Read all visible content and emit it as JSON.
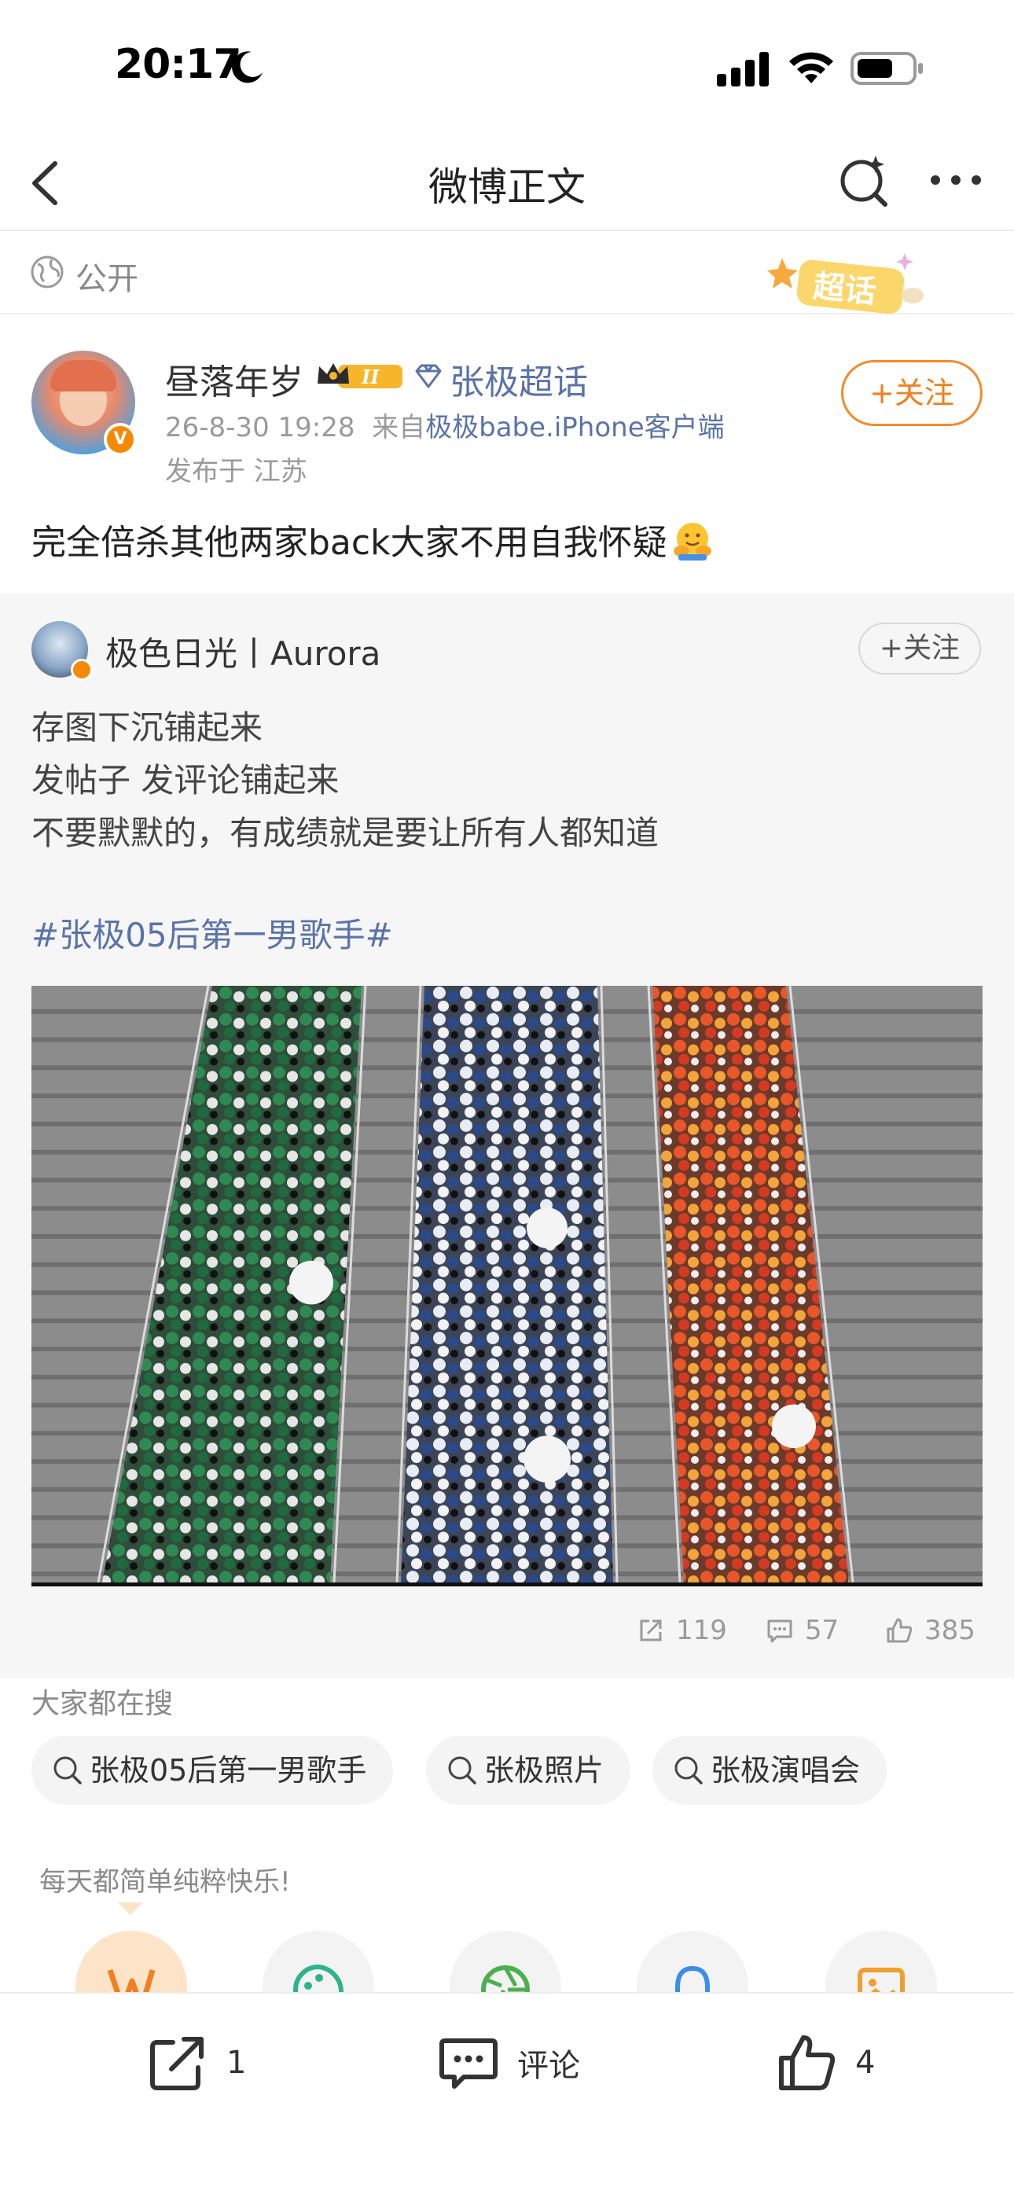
{
  "status_bar": {
    "time": "20:17"
  },
  "nav": {
    "title": "微博正文"
  },
  "visibility": {
    "label": "公开",
    "deco_text": "超话"
  },
  "author": {
    "name": "昼落年岁",
    "vip_level": "II",
    "chaohua": "张极超话",
    "verified": "V",
    "time": "26-8-30 19:28",
    "source_prefix": "来自",
    "source": "极极babe.iPhone客户端",
    "location": "发布于 江苏",
    "follow_label": "+关注"
  },
  "post": {
    "text": "完全倍杀其他两家back大家不用自我怀疑",
    "emoji": "hug-emoji"
  },
  "repost": {
    "author_name": "极色日光丨Aurora",
    "follow_label": "+关注",
    "lines": [
      "存图下沉铺起来",
      "发帖子 发评论铺起来",
      "不要默默的，有成绩就是要让所有人都知道"
    ],
    "topic": "#张极05后第一男歌手#",
    "stats": {
      "reposts": "119",
      "comments": "57",
      "likes": "385"
    }
  },
  "search": {
    "heading": "大家都在搜",
    "chips": [
      "张极05后第一男歌手",
      "张极照片",
      "张极演唱会"
    ]
  },
  "daily": {
    "text": "每天都简单纯粹快乐!"
  },
  "toolbar": {
    "repost_count": "1",
    "comment_label": "评论",
    "like_count": "4"
  },
  "colors": {
    "accent": "#f08020",
    "link": "#5a73a8",
    "muted": "#9a9a9a"
  }
}
